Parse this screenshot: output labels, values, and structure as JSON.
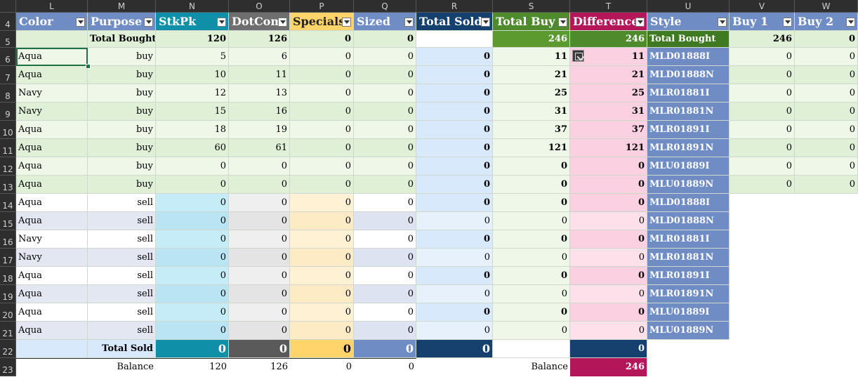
{
  "columns": [
    "L",
    "M",
    "N",
    "O",
    "P",
    "Q",
    "R",
    "S",
    "T",
    "U",
    "V",
    "W"
  ],
  "rows": [
    "4",
    "5",
    "6",
    "7",
    "8",
    "9",
    "10",
    "11",
    "12",
    "13",
    "14",
    "15",
    "16",
    "17",
    "18",
    "19",
    "20",
    "21",
    "22",
    "23"
  ],
  "headers": [
    "Color",
    "Purpose",
    "StkPk",
    "DotCom",
    "Specials",
    "Sized",
    "Total Sold",
    "Total Buy",
    "Difference",
    "Style",
    "Buy 1",
    "Buy 2"
  ],
  "total_bought_row": {
    "label": "Total Bought",
    "stkpk": "120",
    "dotcom": "126",
    "specials": "0",
    "sized": "0",
    "total_buy": "246",
    "difference": "246",
    "style_label": "Total Bought",
    "buy1": "246",
    "buy2": "0"
  },
  "data_rows": [
    {
      "color": "Aqua",
      "purpose": "buy",
      "stkpk": "5",
      "dotcom": "6",
      "specials": "0",
      "sized": "0",
      "total_sold": "0",
      "total_buy": "11",
      "difference": "11",
      "style": "MLD01888I",
      "buy1": "0",
      "buy2": "0"
    },
    {
      "color": "Aqua",
      "purpose": "buy",
      "stkpk": "10",
      "dotcom": "11",
      "specials": "0",
      "sized": "0",
      "total_sold": "0",
      "total_buy": "21",
      "difference": "21",
      "style": "MLD01888N",
      "buy1": "0",
      "buy2": "0"
    },
    {
      "color": "Navy",
      "purpose": "buy",
      "stkpk": "12",
      "dotcom": "13",
      "specials": "0",
      "sized": "0",
      "total_sold": "0",
      "total_buy": "25",
      "difference": "25",
      "style": "MLR01881I",
      "buy1": "0",
      "buy2": "0"
    },
    {
      "color": "Navy",
      "purpose": "buy",
      "stkpk": "15",
      "dotcom": "16",
      "specials": "0",
      "sized": "0",
      "total_sold": "0",
      "total_buy": "31",
      "difference": "31",
      "style": "MLR01881N",
      "buy1": "0",
      "buy2": "0"
    },
    {
      "color": "Aqua",
      "purpose": "buy",
      "stkpk": "18",
      "dotcom": "19",
      "specials": "0",
      "sized": "0",
      "total_sold": "0",
      "total_buy": "37",
      "difference": "37",
      "style": "MLR01891I",
      "buy1": "0",
      "buy2": "0"
    },
    {
      "color": "Aqua",
      "purpose": "buy",
      "stkpk": "60",
      "dotcom": "61",
      "specials": "0",
      "sized": "0",
      "total_sold": "0",
      "total_buy": "121",
      "difference": "121",
      "style": "MLR01891N",
      "buy1": "0",
      "buy2": "0"
    },
    {
      "color": "Aqua",
      "purpose": "buy",
      "stkpk": "0",
      "dotcom": "0",
      "specials": "0",
      "sized": "0",
      "total_sold": "0",
      "total_buy": "0",
      "difference": "0",
      "style": "MLU01889I",
      "buy1": "0",
      "buy2": "0"
    },
    {
      "color": "Aqua",
      "purpose": "buy",
      "stkpk": "0",
      "dotcom": "0",
      "specials": "0",
      "sized": "0",
      "total_sold": "0",
      "total_buy": "0",
      "difference": "0",
      "style": "MLU01889N",
      "buy1": "0",
      "buy2": "0"
    },
    {
      "color": "Aqua",
      "purpose": "sell",
      "stkpk": "0",
      "dotcom": "0",
      "specials": "0",
      "sized": "0",
      "total_sold": "0",
      "total_buy": "0",
      "difference": "0",
      "style": "MLD01888I",
      "buy1": "",
      "buy2": ""
    },
    {
      "color": "Aqua",
      "purpose": "sell",
      "stkpk": "0",
      "dotcom": "0",
      "specials": "0",
      "sized": "0",
      "total_sold": "0",
      "total_buy": "0",
      "difference": "0",
      "style": "MLD01888N",
      "buy1": "",
      "buy2": ""
    },
    {
      "color": "Navy",
      "purpose": "sell",
      "stkpk": "0",
      "dotcom": "0",
      "specials": "0",
      "sized": "0",
      "total_sold": "0",
      "total_buy": "0",
      "difference": "0",
      "style": "MLR01881I",
      "buy1": "",
      "buy2": ""
    },
    {
      "color": "Navy",
      "purpose": "sell",
      "stkpk": "0",
      "dotcom": "0",
      "specials": "0",
      "sized": "0",
      "total_sold": "0",
      "total_buy": "0",
      "difference": "0",
      "style": "MLR01881N",
      "buy1": "",
      "buy2": ""
    },
    {
      "color": "Aqua",
      "purpose": "sell",
      "stkpk": "0",
      "dotcom": "0",
      "specials": "0",
      "sized": "0",
      "total_sold": "0",
      "total_buy": "0",
      "difference": "0",
      "style": "MLR01891I",
      "buy1": "",
      "buy2": ""
    },
    {
      "color": "Aqua",
      "purpose": "sell",
      "stkpk": "0",
      "dotcom": "0",
      "specials": "0",
      "sized": "0",
      "total_sold": "0",
      "total_buy": "0",
      "difference": "0",
      "style": "MLR01891N",
      "buy1": "",
      "buy2": ""
    },
    {
      "color": "Aqua",
      "purpose": "sell",
      "stkpk": "0",
      "dotcom": "0",
      "specials": "0",
      "sized": "0",
      "total_sold": "0",
      "total_buy": "0",
      "difference": "0",
      "style": "MLU01889I",
      "buy1": "",
      "buy2": ""
    },
    {
      "color": "Aqua",
      "purpose": "sell",
      "stkpk": "0",
      "dotcom": "0",
      "specials": "0",
      "sized": "0",
      "total_sold": "0",
      "total_buy": "0",
      "difference": "0",
      "style": "MLU01889N",
      "buy1": "",
      "buy2": ""
    }
  ],
  "total_sold_row": {
    "label": "Total Sold",
    "stkpk": "0",
    "dotcom": "0",
    "specials": "0",
    "sized": "0",
    "total_sold": "0",
    "difference": "0"
  },
  "balance_row": {
    "label": "Balance",
    "stkpk": "120",
    "dotcom": "126",
    "specials": "0",
    "sized": "0",
    "total_buy_label": "Balance",
    "difference": "246"
  },
  "colors": {
    "header_blue": "#6f8cc4",
    "header_teal": "#0f8fa8",
    "header_gray": "#6e6e6e",
    "header_gold": "#ffd56b",
    "header_navy": "#16406e",
    "header_green": "#4f8a2c",
    "header_magenta": "#b3175a",
    "stripe_green_a": "#eef7e8",
    "stripe_green_b": "#e0f0d6",
    "blue_light": "#d7e9fb",
    "pink": "#fbd1e1"
  }
}
